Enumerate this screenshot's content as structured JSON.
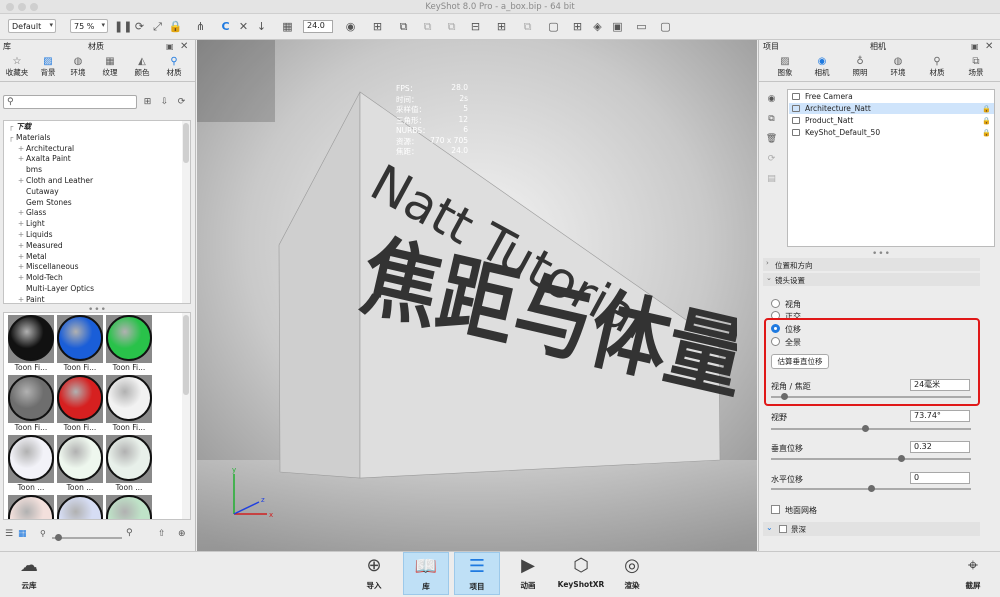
{
  "window": {
    "title": "KeyShot 8.0 Pro - a_box.bip - 64 bit"
  },
  "toolbar": {
    "workspace": "Default",
    "zoom": "75 %",
    "cpu_value": "24.0",
    "icons": [
      "pause-icon",
      "refresh-icon",
      "expand-icon",
      "lock-icon",
      "network-icon",
      "update-icon",
      "fit-icon",
      "download-icon",
      "viewport-icon",
      "camera-icon",
      "geometry-icon",
      "scene-icon",
      "split-icon",
      "node-icon",
      "monitor-icon",
      "box-icon"
    ]
  },
  "library": {
    "header": "库",
    "title": "材质",
    "tabs": [
      "收藏夹",
      "背景",
      "环境",
      "纹理",
      "颜色",
      "材质"
    ],
    "active_tab": "材质",
    "search_placeholder": "",
    "tree": [
      {
        "label": "下载",
        "indent": 0,
        "bold": true,
        "expand": false
      },
      {
        "label": "Materials",
        "indent": 0,
        "bold": false,
        "expand": false
      },
      {
        "label": "Architectural",
        "indent": 1,
        "expand": true
      },
      {
        "label": "Axalta Paint",
        "indent": 1,
        "expand": true
      },
      {
        "label": "bms",
        "indent": 1,
        "expand": false
      },
      {
        "label": "Cloth and Leather",
        "indent": 1,
        "expand": true
      },
      {
        "label": "Cutaway",
        "indent": 1,
        "expand": false
      },
      {
        "label": "Gem Stones",
        "indent": 1,
        "expand": false
      },
      {
        "label": "Glass",
        "indent": 1,
        "expand": true
      },
      {
        "label": "Light",
        "indent": 1,
        "expand": true
      },
      {
        "label": "Liquids",
        "indent": 1,
        "expand": true
      },
      {
        "label": "Measured",
        "indent": 1,
        "expand": true
      },
      {
        "label": "Metal",
        "indent": 1,
        "expand": true
      },
      {
        "label": "Miscellaneous",
        "indent": 1,
        "expand": true
      },
      {
        "label": "Mold-Tech",
        "indent": 1,
        "expand": true
      },
      {
        "label": "Multi-Layer Optics",
        "indent": 1,
        "expand": false
      },
      {
        "label": "Paint",
        "indent": 1,
        "expand": true
      }
    ],
    "swatches": [
      {
        "label": "Toon Fi...",
        "color": "#111111"
      },
      {
        "label": "Toon Fi...",
        "color": "#1a5ed8"
      },
      {
        "label": "Toon Fi...",
        "color": "#29c24a"
      },
      {
        "label": "Toon Fi...",
        "color": "#6e6e6e"
      },
      {
        "label": "Toon Fi...",
        "color": "#d62020"
      },
      {
        "label": "Toon Fi...",
        "color": "#f2f2f2"
      },
      {
        "label": "Toon ...",
        "color": "#f2f2f8"
      },
      {
        "label": "Toon ...",
        "color": "#eef7ee"
      },
      {
        "label": "Toon ...",
        "color": "#e8f0ea"
      },
      {
        "label": "Toon ...",
        "color": "#f3e0dc"
      },
      {
        "label": "Toon ...",
        "color": "#d6ddf4"
      },
      {
        "label": "Toon ...",
        "color": "#bfe3c8"
      }
    ]
  },
  "viewport": {
    "stats": [
      {
        "k": "FPS：",
        "v": "28.0"
      },
      {
        "k": "时间：",
        "v": "2s"
      },
      {
        "k": "采样值：",
        "v": "5"
      },
      {
        "k": "三角形：",
        "v": "12"
      },
      {
        "k": "NURBS：",
        "v": "6"
      },
      {
        "k": "资源：",
        "v": "770 x 705"
      },
      {
        "k": "焦距：",
        "v": "24.0"
      }
    ],
    "scene_text_en": "Natt Tutorial",
    "scene_text_zh": "焦距与体量感",
    "axis": {
      "x": "x",
      "y": "y",
      "z": "z"
    }
  },
  "project": {
    "header": "项目",
    "title": "相机",
    "tabs": [
      "图象",
      "相机",
      "照明",
      "环境",
      "材质",
      "场景"
    ],
    "active_tab": "相机",
    "cameras": [
      {
        "label": "Free Camera",
        "selected": false,
        "locked": false
      },
      {
        "label": "Architecture_Natt",
        "selected": true,
        "locked": true
      },
      {
        "label": "Product_Natt",
        "selected": false,
        "locked": true
      },
      {
        "label": "KeyShot_Default_50",
        "selected": false,
        "locked": true
      }
    ],
    "sections": {
      "position": "位置和方向",
      "lens": "镜头设置"
    },
    "lens": {
      "radio_options": [
        "视角",
        "正交",
        "位移",
        "全景"
      ],
      "selected": "位移",
      "estimate_button": "估算垂直位移",
      "focal_label": "视角 / 焦距",
      "focal_value": "24毫米",
      "focal_level": 0.05,
      "fov_label": "视野",
      "fov_value": "73.74°",
      "fov_level": 0.47,
      "vshift_label": "垂直位移",
      "vshift_value": "0.32",
      "vshift_level": 0.66,
      "hshift_label": "水平位移",
      "hshift_value": "0",
      "hshift_level": 0.5
    },
    "ground_grid": "地面网格",
    "dof": "景深"
  },
  "bottom_bar": {
    "cloud": "云库",
    "buttons": [
      "导入",
      "库",
      "项目",
      "动画",
      "KeyShotXR",
      "渲染"
    ],
    "active": [
      "库",
      "项目"
    ],
    "screenshot": "截屏"
  },
  "colors": {
    "accent": "#1f7ae0",
    "highlight_box": "#e01818",
    "selection": "#cfe4fb"
  }
}
